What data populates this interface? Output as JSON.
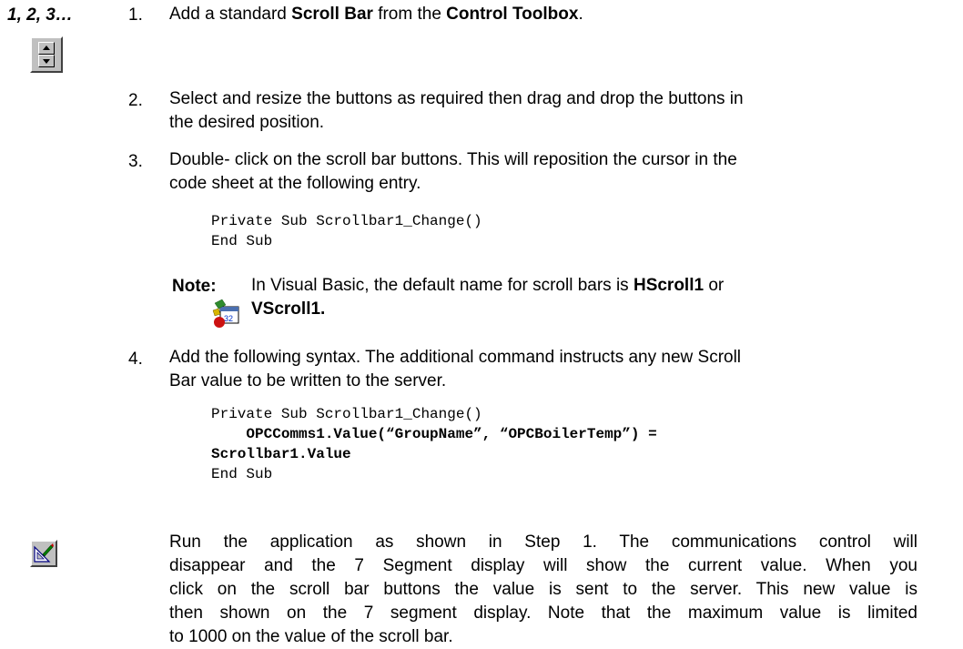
{
  "steps_label": "1, 2, 3…",
  "steps": [
    {
      "num": "1.",
      "parts": {
        "a": "Add a standard ",
        "b": "Scroll Bar",
        "c": " from the ",
        "d": "Control Toolbox",
        "e": "."
      }
    },
    {
      "num": "2.",
      "lines": [
        "Select and resize the buttons as required then drag and drop the buttons in",
        "the desired position."
      ]
    },
    {
      "num": "3.",
      "lines": [
        "Double- click on the scroll bar buttons.  This will reposition the cursor in the",
        "code sheet at the following entry."
      ],
      "code": [
        "Private Sub Scrollbar1_Change()",
        "End Sub"
      ]
    },
    {
      "num": "4.",
      "lines": [
        "Add the following syntax.  The additional command instructs any new Scroll",
        "Bar value to be written to the server."
      ],
      "code": {
        "line1": "Private Sub Scrollbar1_Change()",
        "line2": "    OPCComms1.Value(“GroupName”, “OPCBoilerTemp”) =",
        "line3": "Scrollbar1.Value",
        "line4": "End Sub"
      }
    }
  ],
  "note": {
    "label": "Note:",
    "line1": {
      "a": "In Visual Basic, the default name for scroll bars is ",
      "b": "HScroll1",
      "c": " or"
    },
    "line2": "VScroll1."
  },
  "run_paragraph": [
    "Run the application as shown in Step 1.  The communications control will",
    "disappear and the 7 Segment display will show the current value.  When you",
    "click on the scroll bar buttons the value is sent to the server.  This new value is",
    "then shown on the 7 segment display.  Note that the maximum value is limited",
    "to 1000 on the value of the scroll bar."
  ],
  "icons": {
    "steps": "scrollbar-control-icon",
    "note": "calendar-32-icon",
    "run": "run-application-icon"
  }
}
